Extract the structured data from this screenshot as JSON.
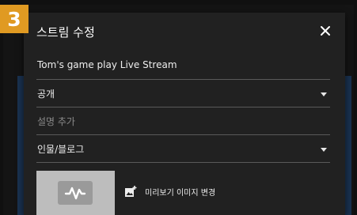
{
  "step_badge": "3",
  "dialog": {
    "title": "스트림 수정",
    "close_icon": "close-icon"
  },
  "form": {
    "title_value": "Tom's game play Live Stream",
    "privacy_value": "공개",
    "description_placeholder": "설명 추가",
    "category_value": "인물/블로그"
  },
  "thumbnail": {
    "icon": "waveform-icon",
    "change_label": "미리보기 이미지 변경",
    "change_icon": "add-image-icon"
  },
  "colors": {
    "badge": "#e09a22",
    "dialog_bg": "#212121",
    "page_bg": "#101010",
    "underline": "#5a5a5a"
  }
}
